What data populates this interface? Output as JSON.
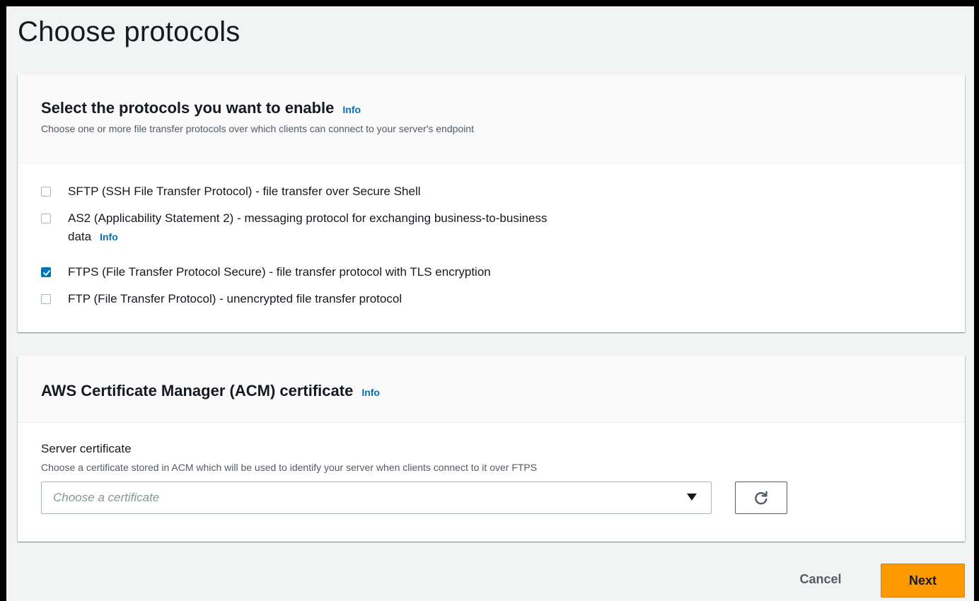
{
  "page": {
    "title": "Choose protocols"
  },
  "protocols_panel": {
    "heading": "Select the protocols you want to enable",
    "info": "Info",
    "description": "Choose one or more file transfer protocols over which clients can connect to your server's endpoint",
    "options": [
      {
        "label": "SFTP (SSH File Transfer Protocol) - file transfer over Secure Shell",
        "checked": false
      },
      {
        "label": "AS2 (Applicability Statement 2) - messaging protocol for exchanging business-to-business",
        "label_cont": "data",
        "info": "Info",
        "checked": false
      },
      {
        "label": "FTPS (File Transfer Protocol Secure) - file transfer protocol with TLS encryption",
        "checked": true
      },
      {
        "label": "FTP (File Transfer Protocol) - unencrypted file transfer protocol",
        "checked": false
      }
    ]
  },
  "acm_panel": {
    "heading": "AWS Certificate Manager (ACM) certificate",
    "info": "Info",
    "field_label": "Server certificate",
    "field_description": "Choose a certificate stored in ACM which will be used to identify your server when clients connect to it over FTPS",
    "select_placeholder": "Choose a certificate",
    "refresh_icon": "refresh-icon"
  },
  "footer": {
    "cancel_label": "Cancel",
    "next_label": "Next"
  },
  "colors": {
    "accent": "#0073bb",
    "primary_button": "#ff9900",
    "background": "#f2f3f3"
  }
}
